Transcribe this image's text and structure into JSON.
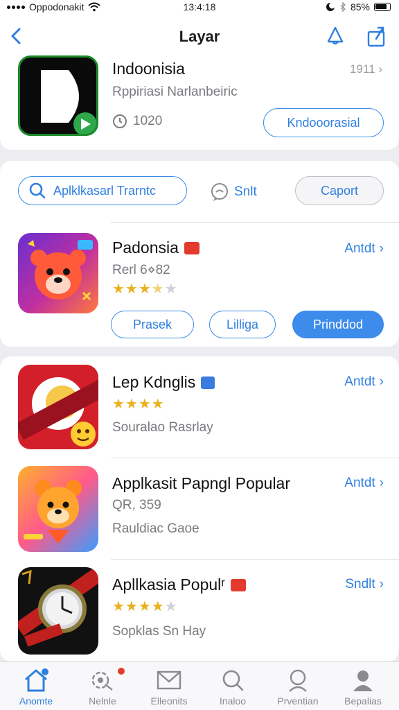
{
  "status_bar": {
    "carrier": "Oppodonakit",
    "time": "13:4:18",
    "battery": "85%"
  },
  "nav": {
    "title": "Layar"
  },
  "featured": {
    "name": "Indoonisia",
    "subtitle": "Rppiriasi Narlanbeiric",
    "meta": "1911",
    "rating_count": "1020",
    "button": "Kndooorasial"
  },
  "filters": {
    "search_chip": "Aplklkasarl Trarntc",
    "chat_chip": "Snlt",
    "capture_chip": "Caport"
  },
  "mid_app": {
    "name": "Padonsia",
    "subtitle": "Rerl 6⋄82",
    "action": "Antdt",
    "rating": 3.5,
    "buttons": [
      "Prasek",
      "Lilliga",
      "Prinddod"
    ]
  },
  "list": [
    {
      "name": "Lep Kdnglis",
      "action": "Antdt",
      "rating": 4,
      "line2": "Souralao Rasrlay"
    },
    {
      "name": "Applkasit Papngl Popular",
      "action": "Antdt",
      "line2": "QR, 359",
      "line3": "Rauldiac Gaoe"
    },
    {
      "name": "Apllkasia Populʳ",
      "action": "Sndlt",
      "rating": 4,
      "line2": "Sopklas Sn Hay"
    }
  ],
  "tabs": [
    {
      "label": "Anomte",
      "icon": "home-icon",
      "active": true
    },
    {
      "label": "Nelnle",
      "icon": "games-icon"
    },
    {
      "label": "Elleonits",
      "icon": "mail-icon"
    },
    {
      "label": "Inaloo",
      "icon": "search-icon"
    },
    {
      "label": "Prventian",
      "icon": "profile-search-icon"
    },
    {
      "label": "Bepalias",
      "icon": "person-icon"
    }
  ],
  "colors": {
    "accent": "#2f7fe0",
    "star": "#e8b21e",
    "badge_red": "#e23b2e",
    "badge_blue": "#3a7be0"
  }
}
